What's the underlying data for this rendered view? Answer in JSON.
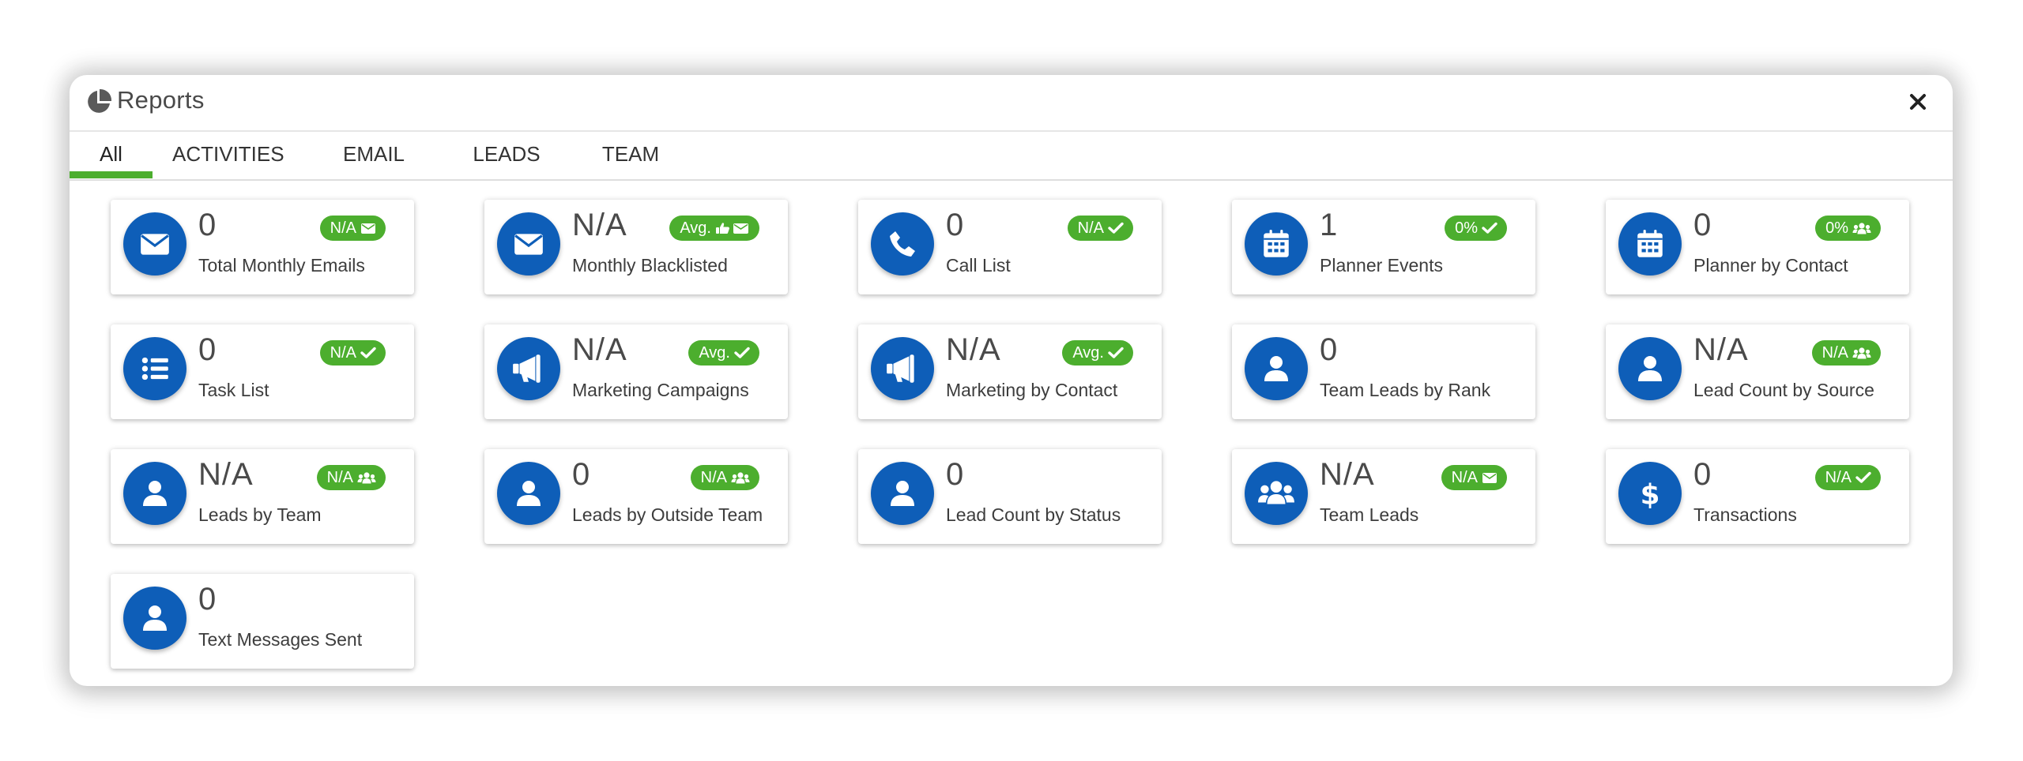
{
  "header": {
    "title": "Reports",
    "icon": "pie-chart-icon",
    "close_icon": "close-icon"
  },
  "tabs": [
    {
      "label": "All",
      "active": true
    },
    {
      "label": "ACTIVITIES",
      "active": false
    },
    {
      "label": "EMAIL",
      "active": false
    },
    {
      "label": "LEADS",
      "active": false
    },
    {
      "label": "TEAM",
      "active": false
    }
  ],
  "colors": {
    "accent_green": "#4cae2e",
    "icon_blue": "#0e5eb8",
    "text": "#3d3d3d"
  },
  "cards": [
    {
      "value": "0",
      "label": "Total Monthly Emails",
      "icon": "envelope-icon",
      "badge": {
        "text": "N/A",
        "icon": "envelope-icon"
      }
    },
    {
      "value": "N/A",
      "label": "Monthly Blacklisted",
      "icon": "envelope-icon",
      "badge": {
        "text": "Avg.",
        "icon": "thumbs-up-envelope-icon"
      }
    },
    {
      "value": "0",
      "label": "Call List",
      "icon": "phone-icon",
      "badge": {
        "text": "N/A",
        "icon": "check-icon"
      }
    },
    {
      "value": "1",
      "label": "Planner Events",
      "icon": "calendar-icon",
      "badge": {
        "text": "0%",
        "icon": "check-icon"
      }
    },
    {
      "value": "0",
      "label": "Planner by Contact",
      "icon": "calendar-icon",
      "badge": {
        "text": "0%",
        "icon": "users-icon"
      }
    },
    {
      "value": "0",
      "label": "Task List",
      "icon": "list-icon",
      "badge": {
        "text": "N/A",
        "icon": "check-icon"
      }
    },
    {
      "value": "N/A",
      "label": "Marketing Campaigns",
      "icon": "megaphone-icon",
      "badge": {
        "text": "Avg.",
        "icon": "check-icon"
      }
    },
    {
      "value": "N/A",
      "label": "Marketing by Contact",
      "icon": "megaphone-icon",
      "badge": {
        "text": "Avg.",
        "icon": "check-icon"
      }
    },
    {
      "value": "0",
      "label": "Team Leads by Rank",
      "icon": "user-icon",
      "badge": null
    },
    {
      "value": "N/A",
      "label": "Lead Count by Source",
      "icon": "user-icon",
      "badge": {
        "text": "N/A",
        "icon": "users-icon"
      }
    },
    {
      "value": "N/A",
      "label": "Leads by Team",
      "icon": "user-icon",
      "badge": {
        "text": "N/A",
        "icon": "users-icon"
      }
    },
    {
      "value": "0",
      "label": "Leads by Outside Team",
      "icon": "user-icon",
      "badge": {
        "text": "N/A",
        "icon": "users-icon"
      }
    },
    {
      "value": "0",
      "label": "Lead Count by Status",
      "icon": "user-icon",
      "badge": null
    },
    {
      "value": "N/A",
      "label": "Team Leads",
      "icon": "users-icon",
      "badge": {
        "text": "N/A",
        "icon": "envelope-icon"
      }
    },
    {
      "value": "0",
      "label": "Transactions",
      "icon": "dollar-icon",
      "badge": {
        "text": "N/A",
        "icon": "check-icon"
      }
    },
    {
      "value": "0",
      "label": "Text Messages Sent",
      "icon": "user-icon",
      "badge": null
    }
  ]
}
